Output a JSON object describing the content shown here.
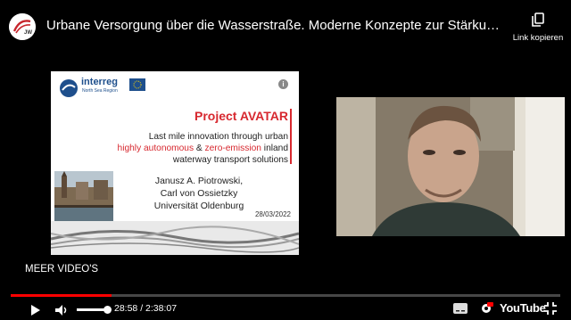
{
  "header": {
    "title": "Urbane Versorgung über die Wasserstraße. Moderne Konzepte zur Stärkung der Binne...",
    "copy_link_label": "Link kopieren"
  },
  "slide": {
    "title": "Project AVATAR",
    "line1": "Last mile innovation through urban",
    "line2_a": "highly autonomous",
    "line2_b": " & ",
    "line2_c": "zero-emission",
    "line2_d": " inland",
    "line3": "waterway transport solutions",
    "author1": "Janusz A. Piotrowski,",
    "author2": "Carl von Ossietzky",
    "author3": "Universität Oldenburg",
    "date": "28/03/2022",
    "logo_text": "interreg",
    "logo_sub": "North Sea Region",
    "info_glyph": "i"
  },
  "overlay": {
    "more_videos": "MEER VIDEO'S"
  },
  "player": {
    "time": "28:58 / 2:38:07",
    "progress_fraction": 0.183,
    "youtube_label": "YouTube",
    "accent": "#ff0000"
  }
}
